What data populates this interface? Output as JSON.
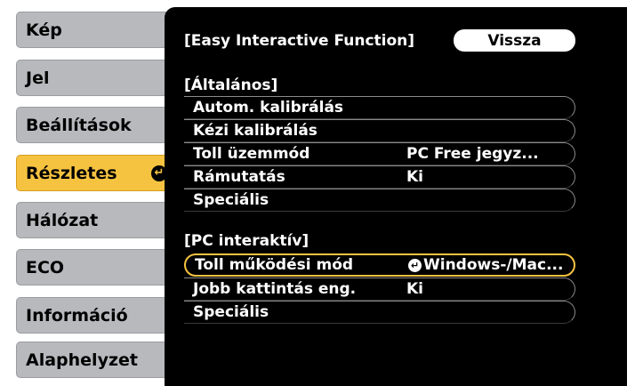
{
  "sidebar": {
    "items": [
      {
        "label": "Kép"
      },
      {
        "label": "Jel"
      },
      {
        "label": "Beállítások"
      },
      {
        "label": "Részletes",
        "selected": true
      },
      {
        "label": "Hálózat"
      },
      {
        "label": "ECO"
      },
      {
        "label": "Információ"
      },
      {
        "label": "Alaphelyzet"
      }
    ],
    "enter_glyph": "↵"
  },
  "main": {
    "title": "[Easy Interactive Function]",
    "back_label": "Vissza",
    "general": {
      "header": "[Általános]",
      "rows": [
        {
          "name": "Autom. kalibrálás",
          "value": ""
        },
        {
          "name": "Kézi kalibrálás",
          "value": ""
        },
        {
          "name": "Toll üzemmód",
          "value": "PC Free jegyz..."
        },
        {
          "name": "Rámutatás",
          "value": "Ki"
        },
        {
          "name": "Speciális",
          "value": ""
        }
      ]
    },
    "pc": {
      "header": "[PC interaktív]",
      "rows": [
        {
          "name": "Toll működési mód",
          "value": "Windows-/Mac...",
          "selected": true
        },
        {
          "name": "Jobb kattintás eng.",
          "value": "Ki"
        },
        {
          "name": "Speciális",
          "value": ""
        }
      ]
    }
  },
  "colors": {
    "menu_bg": "#000000",
    "sidebar_item": "#b7b9bd",
    "selected": "#f6c341"
  }
}
